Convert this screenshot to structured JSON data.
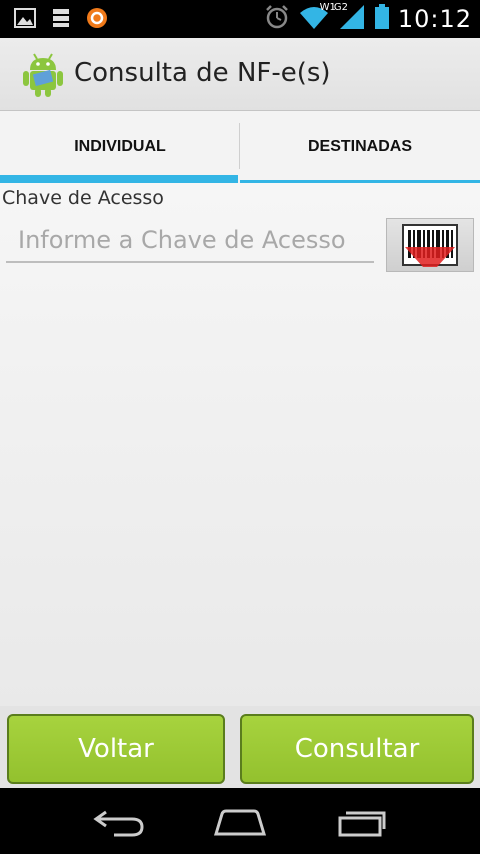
{
  "status_bar": {
    "time": "10:12",
    "network_label_1": "W1",
    "network_label_2": "G2",
    "icons": [
      "gallery-icon",
      "storage-icon",
      "avast-icon",
      "alarm-icon",
      "wifi-icon",
      "signal-icon",
      "battery-icon"
    ]
  },
  "action_bar": {
    "title": "Consulta de NF-e(s)",
    "icon": "android-nfe-icon"
  },
  "tabs": [
    {
      "label": "INDIVIDUAL",
      "selected": true
    },
    {
      "label": "DESTINADAS",
      "selected": false
    }
  ],
  "form": {
    "field_label": "Chave de Acesso",
    "input_value": "",
    "input_placeholder": "Informe a Chave de Acesso",
    "scan_icon": "barcode-scan-icon"
  },
  "buttons": {
    "back_label": "Voltar",
    "submit_label": "Consultar"
  },
  "nav_bar": {
    "icons": [
      "back-icon",
      "home-icon",
      "recent-apps-icon"
    ]
  },
  "colors": {
    "accent": "#33b5e5",
    "button_green": "#9ccb35",
    "button_border": "#5a7d1d"
  }
}
